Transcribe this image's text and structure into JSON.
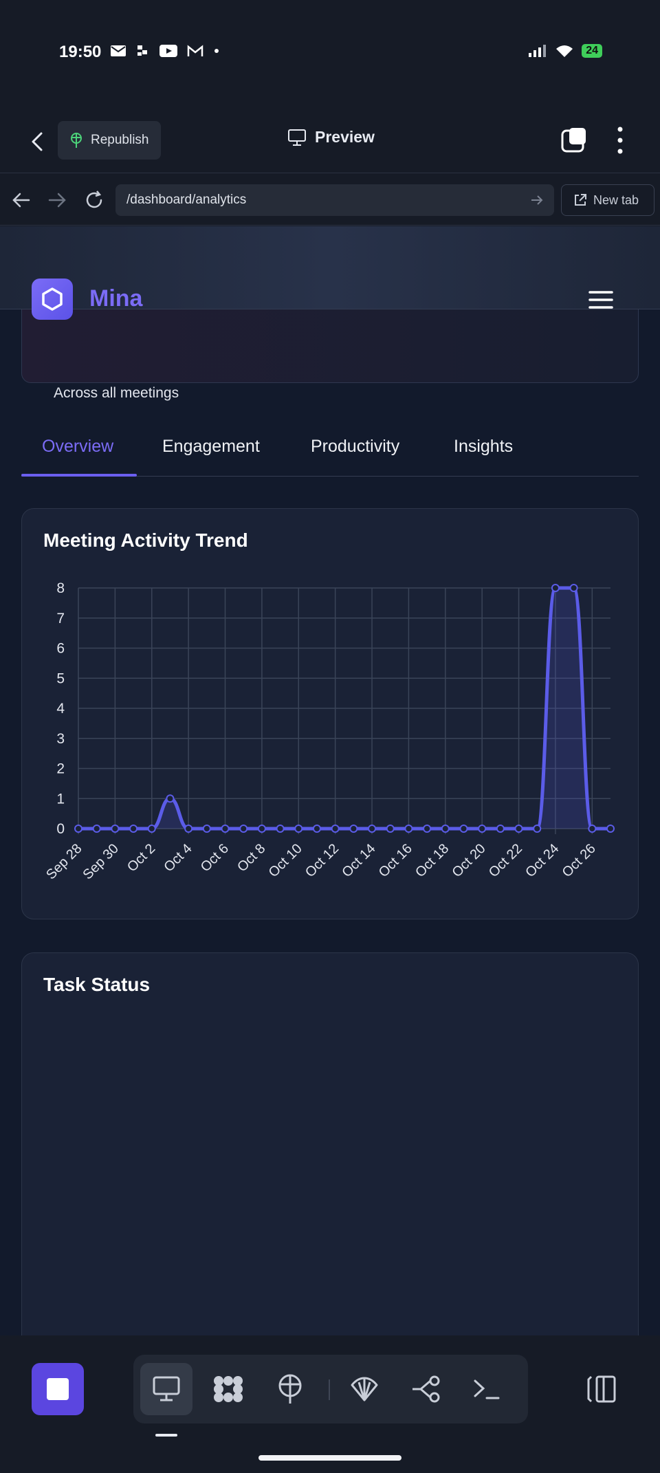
{
  "status_bar": {
    "time": "19:50",
    "battery": "24"
  },
  "app_header": {
    "republish_label": "Republish",
    "preview_label": "Preview"
  },
  "browser": {
    "url": "/dashboard/analytics",
    "new_tab_label": "New tab"
  },
  "site": {
    "brand": "Mina",
    "stat_subtitle": "Across all meetings"
  },
  "tabs": [
    {
      "label": "Overview",
      "active": true
    },
    {
      "label": "Engagement",
      "active": false
    },
    {
      "label": "Productivity",
      "active": false
    },
    {
      "label": "Insights",
      "active": false
    }
  ],
  "cards": {
    "activity_title": "Meeting Activity Trend",
    "task_title": "Task Status"
  },
  "colors": {
    "accent": "#6b5ff0",
    "line": "#5b5ce8",
    "background": "#121a2c",
    "card": "#1a2236"
  },
  "chart_data": {
    "type": "line",
    "title": "Meeting Activity Trend",
    "x": [
      "Sep 28",
      "Sep 29",
      "Sep 30",
      "Oct 1",
      "Oct 2",
      "Oct 3",
      "Oct 4",
      "Oct 5",
      "Oct 6",
      "Oct 7",
      "Oct 8",
      "Oct 9",
      "Oct 10",
      "Oct 11",
      "Oct 12",
      "Oct 13",
      "Oct 14",
      "Oct 15",
      "Oct 16",
      "Oct 17",
      "Oct 18",
      "Oct 19",
      "Oct 20",
      "Oct 21",
      "Oct 22",
      "Oct 23",
      "Oct 24",
      "Oct 25",
      "Oct 26",
      "Oct 27"
    ],
    "x_tick_labels": [
      "Sep 28",
      "Sep 30",
      "Oct 2",
      "Oct 4",
      "Oct 6",
      "Oct 8",
      "Oct 10",
      "Oct 12",
      "Oct 14",
      "Oct 16",
      "Oct 18",
      "Oct 20",
      "Oct 22",
      "Oct 24",
      "Oct 26"
    ],
    "values": [
      0,
      0,
      0,
      0,
      0,
      1,
      0,
      0,
      0,
      0,
      0,
      0,
      0,
      0,
      0,
      0,
      0,
      0,
      0,
      0,
      0,
      0,
      0,
      0,
      0,
      0,
      8,
      8,
      0,
      0
    ],
    "ylim": [
      0,
      8
    ],
    "y_ticks": [
      0,
      1,
      2,
      3,
      4,
      5,
      6,
      7,
      8
    ],
    "grid": true,
    "fill": true,
    "xlabel": "",
    "ylabel": ""
  }
}
